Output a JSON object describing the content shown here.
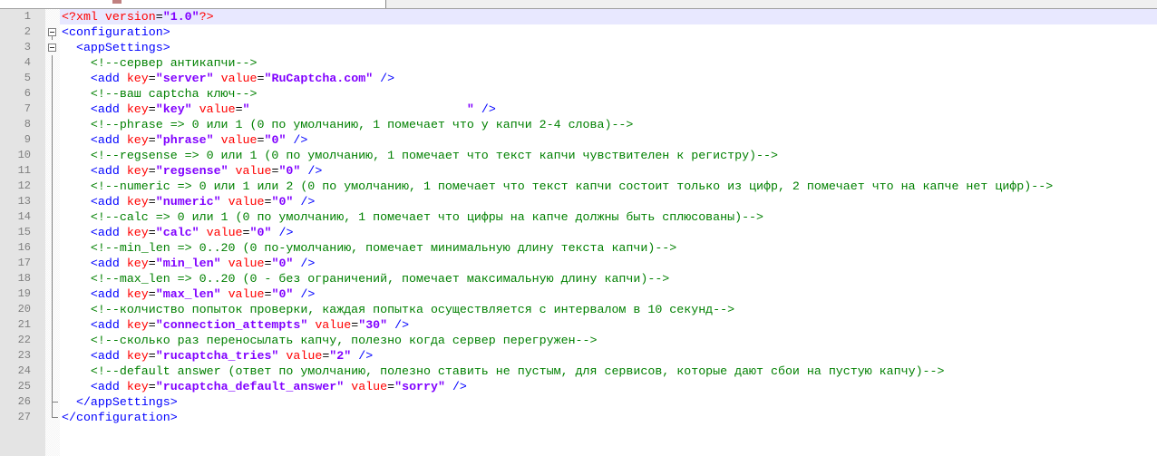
{
  "colors": {
    "tag": "#0000ff",
    "attr": "#ff0000",
    "string": "#8000ff",
    "comment": "#008000"
  },
  "lines": [
    [
      [
        "decl",
        "<?xml "
      ],
      [
        "attr",
        "version"
      ],
      [
        "txt",
        "="
      ],
      [
        "str",
        "\"1.0\""
      ],
      [
        "decl",
        "?>"
      ]
    ],
    [
      [
        "tag",
        "<configuration>"
      ]
    ],
    [
      [
        "txt",
        "  "
      ],
      [
        "tag",
        "<appSettings>"
      ]
    ],
    [
      [
        "txt",
        "    "
      ],
      [
        "com",
        "<!--сервер антикапчи-->"
      ]
    ],
    [
      [
        "txt",
        "    "
      ],
      [
        "tag",
        "<add "
      ],
      [
        "attr",
        "key"
      ],
      [
        "txt",
        "="
      ],
      [
        "str",
        "\"server\""
      ],
      [
        "attr",
        " value"
      ],
      [
        "txt",
        "="
      ],
      [
        "str",
        "\"RuCaptcha.com\""
      ],
      [
        "tag",
        " />"
      ]
    ],
    [
      [
        "txt",
        "    "
      ],
      [
        "com",
        "<!--ваш captcha ключ-->"
      ]
    ],
    [
      [
        "txt",
        "    "
      ],
      [
        "tag",
        "<add "
      ],
      [
        "attr",
        "key"
      ],
      [
        "txt",
        "="
      ],
      [
        "str",
        "\"key\""
      ],
      [
        "attr",
        " value"
      ],
      [
        "txt",
        "="
      ],
      [
        "str",
        "\"                              \""
      ],
      [
        "tag",
        " />"
      ]
    ],
    [
      [
        "txt",
        "    "
      ],
      [
        "com",
        "<!--phrase => 0 или 1 (0 по умолчанию, 1 помечает что у капчи 2-4 слова)-->"
      ]
    ],
    [
      [
        "txt",
        "    "
      ],
      [
        "tag",
        "<add "
      ],
      [
        "attr",
        "key"
      ],
      [
        "txt",
        "="
      ],
      [
        "str",
        "\"phrase\""
      ],
      [
        "attr",
        " value"
      ],
      [
        "txt",
        "="
      ],
      [
        "str",
        "\"0\""
      ],
      [
        "tag",
        " />"
      ]
    ],
    [
      [
        "txt",
        "    "
      ],
      [
        "com",
        "<!--regsense => 0 или 1 (0 по умолчанию, 1 помечает что текст капчи чувствителен к регистру)-->"
      ]
    ],
    [
      [
        "txt",
        "    "
      ],
      [
        "tag",
        "<add "
      ],
      [
        "attr",
        "key"
      ],
      [
        "txt",
        "="
      ],
      [
        "str",
        "\"regsense\""
      ],
      [
        "attr",
        " value"
      ],
      [
        "txt",
        "="
      ],
      [
        "str",
        "\"0\""
      ],
      [
        "tag",
        " />"
      ]
    ],
    [
      [
        "txt",
        "    "
      ],
      [
        "com",
        "<!--numeric => 0 или 1 или 2 (0 по умолчанию, 1 помечает что текст капчи состоит только из цифр, 2 помечает что на капче нет цифр)-->"
      ]
    ],
    [
      [
        "txt",
        "    "
      ],
      [
        "tag",
        "<add "
      ],
      [
        "attr",
        "key"
      ],
      [
        "txt",
        "="
      ],
      [
        "str",
        "\"numeric\""
      ],
      [
        "attr",
        " value"
      ],
      [
        "txt",
        "="
      ],
      [
        "str",
        "\"0\""
      ],
      [
        "tag",
        " />"
      ]
    ],
    [
      [
        "txt",
        "    "
      ],
      [
        "com",
        "<!--calc => 0 или 1 (0 по умолчанию, 1 помечает что цифры на капче должны быть сплюсованы)-->"
      ]
    ],
    [
      [
        "txt",
        "    "
      ],
      [
        "tag",
        "<add "
      ],
      [
        "attr",
        "key"
      ],
      [
        "txt",
        "="
      ],
      [
        "str",
        "\"calc\""
      ],
      [
        "attr",
        " value"
      ],
      [
        "txt",
        "="
      ],
      [
        "str",
        "\"0\""
      ],
      [
        "tag",
        " />"
      ]
    ],
    [
      [
        "txt",
        "    "
      ],
      [
        "com",
        "<!--min_len => 0..20 (0 по-умолчанию, помечает минимальную длину текста капчи)-->"
      ]
    ],
    [
      [
        "txt",
        "    "
      ],
      [
        "tag",
        "<add "
      ],
      [
        "attr",
        "key"
      ],
      [
        "txt",
        "="
      ],
      [
        "str",
        "\"min_len\""
      ],
      [
        "attr",
        " value"
      ],
      [
        "txt",
        "="
      ],
      [
        "str",
        "\"0\""
      ],
      [
        "tag",
        " />"
      ]
    ],
    [
      [
        "txt",
        "    "
      ],
      [
        "com",
        "<!--max_len => 0..20 (0 - без ограничений, помечает максимальную длину капчи)-->"
      ]
    ],
    [
      [
        "txt",
        "    "
      ],
      [
        "tag",
        "<add "
      ],
      [
        "attr",
        "key"
      ],
      [
        "txt",
        "="
      ],
      [
        "str",
        "\"max_len\""
      ],
      [
        "attr",
        " value"
      ],
      [
        "txt",
        "="
      ],
      [
        "str",
        "\"0\""
      ],
      [
        "tag",
        " />"
      ]
    ],
    [
      [
        "txt",
        "    "
      ],
      [
        "com",
        "<!--колчиство попыток проверки, каждая попытка осуществляется с интервалом в 10 секунд-->"
      ]
    ],
    [
      [
        "txt",
        "    "
      ],
      [
        "tag",
        "<add "
      ],
      [
        "attr",
        "key"
      ],
      [
        "txt",
        "="
      ],
      [
        "str",
        "\"connection_attempts\""
      ],
      [
        "attr",
        " value"
      ],
      [
        "txt",
        "="
      ],
      [
        "str",
        "\"30\""
      ],
      [
        "tag",
        " />"
      ]
    ],
    [
      [
        "txt",
        "    "
      ],
      [
        "com",
        "<!--сколько раз переносылать капчу, полезно когда сервер перегружен-->"
      ]
    ],
    [
      [
        "txt",
        "    "
      ],
      [
        "tag",
        "<add "
      ],
      [
        "attr",
        "key"
      ],
      [
        "txt",
        "="
      ],
      [
        "str",
        "\"rucaptcha_tries\""
      ],
      [
        "attr",
        " value"
      ],
      [
        "txt",
        "="
      ],
      [
        "str",
        "\"2\""
      ],
      [
        "tag",
        " />"
      ]
    ],
    [
      [
        "txt",
        "    "
      ],
      [
        "com",
        "<!--default answer (ответ по умолчанию, полезно ставить не пустым, для сервисов, которые дают сбои на пустую капчу)-->"
      ]
    ],
    [
      [
        "txt",
        "    "
      ],
      [
        "tag",
        "<add "
      ],
      [
        "attr",
        "key"
      ],
      [
        "txt",
        "="
      ],
      [
        "str",
        "\"rucaptcha_default_answer\""
      ],
      [
        "attr",
        " value"
      ],
      [
        "txt",
        "="
      ],
      [
        "str",
        "\"sorry\""
      ],
      [
        "tag",
        " />"
      ]
    ],
    [
      [
        "txt",
        "  "
      ],
      [
        "tag",
        "</appSettings>"
      ]
    ],
    [
      [
        "tag",
        "</configuration>"
      ]
    ]
  ]
}
